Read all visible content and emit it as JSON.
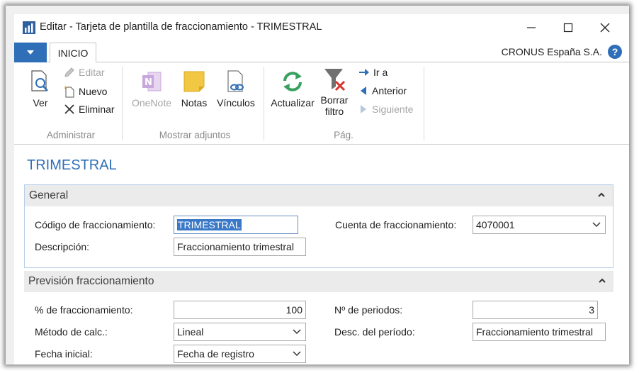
{
  "window": {
    "title": "Editar - Tarjeta de plantilla de fraccionamiento - TRIMESTRAL",
    "minimize_icon": "minimize-icon",
    "maximize_icon": "maximize-icon",
    "close_icon": "close-icon"
  },
  "ribbon_tabs": {
    "active_tab": "INICIO",
    "company": "CRONUS España S.A.",
    "help": "?"
  },
  "ribbon": {
    "groups": [
      {
        "label": "Administrar"
      },
      {
        "label": "Mostrar adjuntos"
      },
      {
        "label": "Pág."
      }
    ],
    "ver": "Ver",
    "editar": "Editar",
    "nuevo": "Nuevo",
    "eliminar": "Eliminar",
    "onenote": "OneNote",
    "notas": "Notas",
    "vinculos": "Vínculos",
    "actualizar": "Actualizar",
    "borrar_filtro_1": "Borrar",
    "borrar_filtro_2": "filtro",
    "ir_a": "Ir a",
    "anterior": "Anterior",
    "siguiente": "Siguiente"
  },
  "page": {
    "title": "TRIMESTRAL"
  },
  "general": {
    "header": "General",
    "codigo_label": "Código de fraccionamiento:",
    "codigo_value": "TRIMESTRAL",
    "descripcion_label": "Descripción:",
    "descripcion_value": "Fraccionamiento trimestral",
    "cuenta_label": "Cuenta de fraccionamiento:",
    "cuenta_value": "4070001"
  },
  "prevision": {
    "header": "Previsión fraccionamiento",
    "pct_label": "% de fraccionamiento:",
    "pct_value": "100",
    "metodo_label": "Método de calc.:",
    "metodo_value": "Lineal",
    "fecha_label": "Fecha inicial:",
    "fecha_value": "Fecha de registro",
    "periodos_label": "Nº de periodos:",
    "periodos_value": "3",
    "desc_periodo_label": "Desc. del período:",
    "desc_periodo_value": "Fraccionamiento trimestral"
  },
  "colors": {
    "accent": "#2f6fb7",
    "section_bg": "#ebebeb",
    "selection": "#3a78c8",
    "refresh_green": "#3aa060",
    "filter_red": "#d9342b",
    "notes_yellow": "#f2c744",
    "onenote_purple": "#a374c7"
  }
}
